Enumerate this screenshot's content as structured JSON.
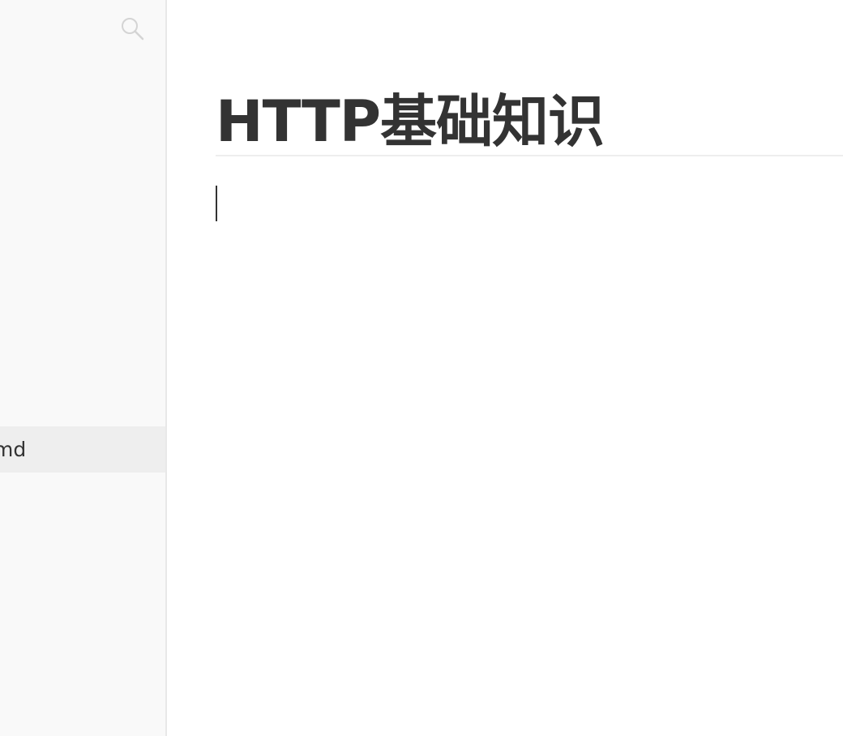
{
  "sidebar": {
    "search_icon": "search-icon",
    "files": [
      {
        "label": "md",
        "active": true
      }
    ]
  },
  "editor": {
    "title": "HTTP基础知识"
  },
  "colors": {
    "sidebar_bg": "#f9f9f9",
    "active_item_bg": "#eeeeee",
    "text": "#333333"
  }
}
